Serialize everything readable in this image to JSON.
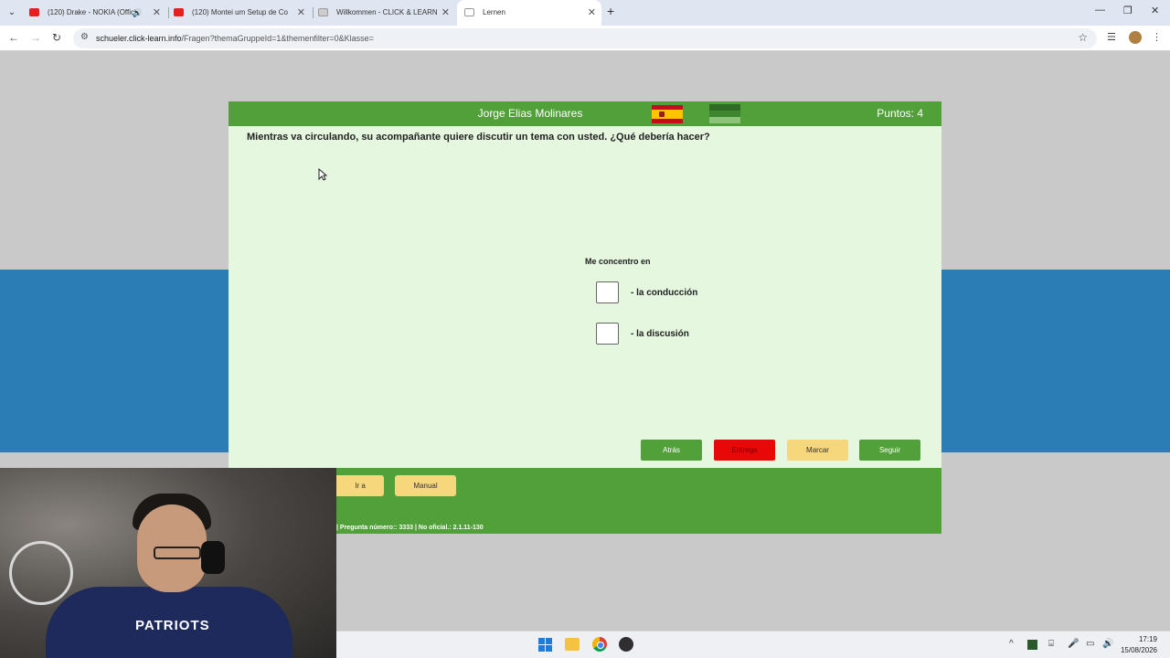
{
  "browser": {
    "tabs": [
      {
        "label": "(120) Drake - NOKIA (Offici",
        "favicon": "youtube-icon",
        "speaker": "🔊"
      },
      {
        "label": "(120) Montei um Setup de Co",
        "favicon": "youtube-icon"
      },
      {
        "label": "Willkommen - CLICK & LEARN",
        "favicon": "clicklearn-icon"
      },
      {
        "label": "Lernen",
        "favicon": "page-icon"
      }
    ],
    "url_host": "schueler.click-learn.info",
    "url_path": "/Fragen?themaGruppeId=1&themenfilter=0&Klasse="
  },
  "quiz": {
    "user_name": "Jorge Elias Molinares",
    "points_label": "Puntos: 4",
    "question": "Mientras va circulando, su acompañante quiere discutir un tema con usted. ¿Qué debería hacer?",
    "prompt": "Me concentro en",
    "answers": [
      {
        "label": "- la conducción",
        "checked": false
      },
      {
        "label": "- la discusión",
        "checked": false
      }
    ],
    "buttons": {
      "back": "Atrás",
      "submit": "Entrega",
      "mark": "Marcar",
      "next": "Seguir"
    },
    "colors": {
      "header": "#52a03a",
      "body": "#e5f7de",
      "submit": "#e80808",
      "mark": "#f7d77c"
    }
  },
  "footer": {
    "goto": "Ir a",
    "manual": "Manual",
    "status": "| Pregunta número:: 3333 | No oficial.: 2.1.11-130"
  },
  "webcam": {
    "shirt_text": "PATRIOTS"
  },
  "taskbar": {
    "time": "17:19",
    "date": "15/08/2026"
  }
}
